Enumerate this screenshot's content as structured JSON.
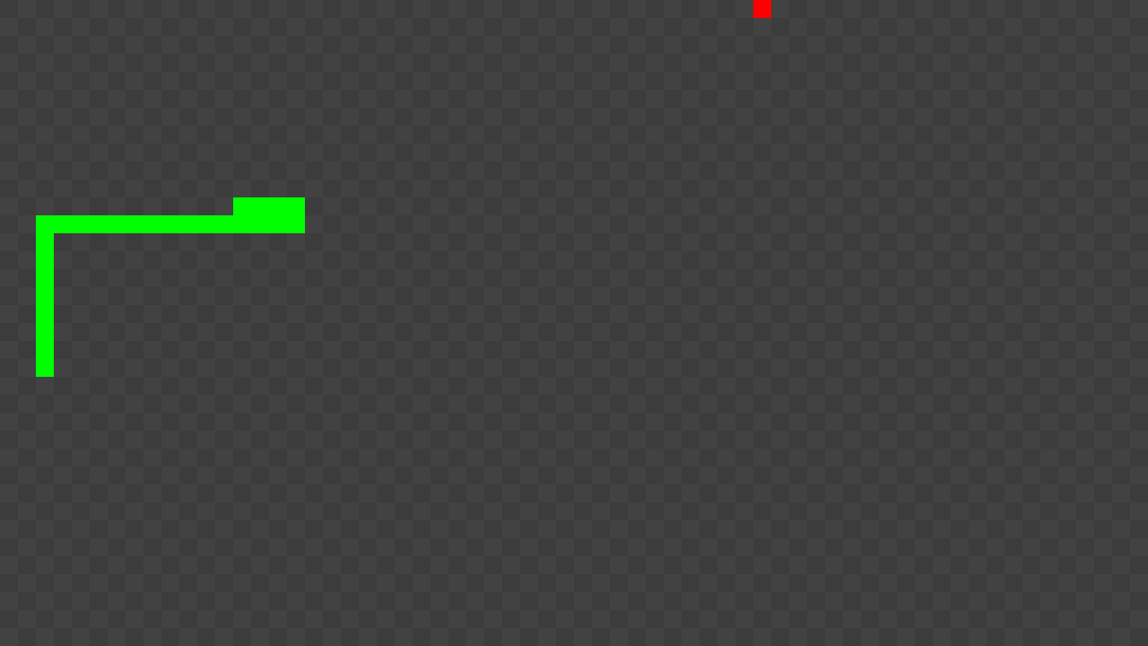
{
  "game": {
    "colors": {
      "board_light": "#424242",
      "board_dark": "#3c3c3c",
      "snake": "#00ff00",
      "food": "#ff0000"
    },
    "grid": {
      "columns": 64,
      "rows": 36
    },
    "snake": {
      "segments": [
        [
          2,
          20
        ],
        [
          2,
          19
        ],
        [
          2,
          18
        ],
        [
          2,
          17
        ],
        [
          2,
          16
        ],
        [
          2,
          15
        ],
        [
          2,
          14
        ],
        [
          2,
          13
        ],
        [
          2,
          12
        ],
        [
          3,
          12
        ],
        [
          4,
          12
        ],
        [
          5,
          12
        ],
        [
          6,
          12
        ],
        [
          7,
          12
        ],
        [
          8,
          12
        ],
        [
          9,
          12
        ],
        [
          10,
          12
        ],
        [
          11,
          12
        ],
        [
          12,
          12
        ],
        [
          13,
          12
        ],
        [
          14,
          12
        ],
        [
          15,
          12
        ],
        [
          16,
          12
        ],
        [
          13,
          11
        ],
        [
          14,
          11
        ],
        [
          15,
          11
        ],
        [
          16,
          11
        ]
      ]
    },
    "food": {
      "cell": [
        42,
        0
      ]
    }
  }
}
